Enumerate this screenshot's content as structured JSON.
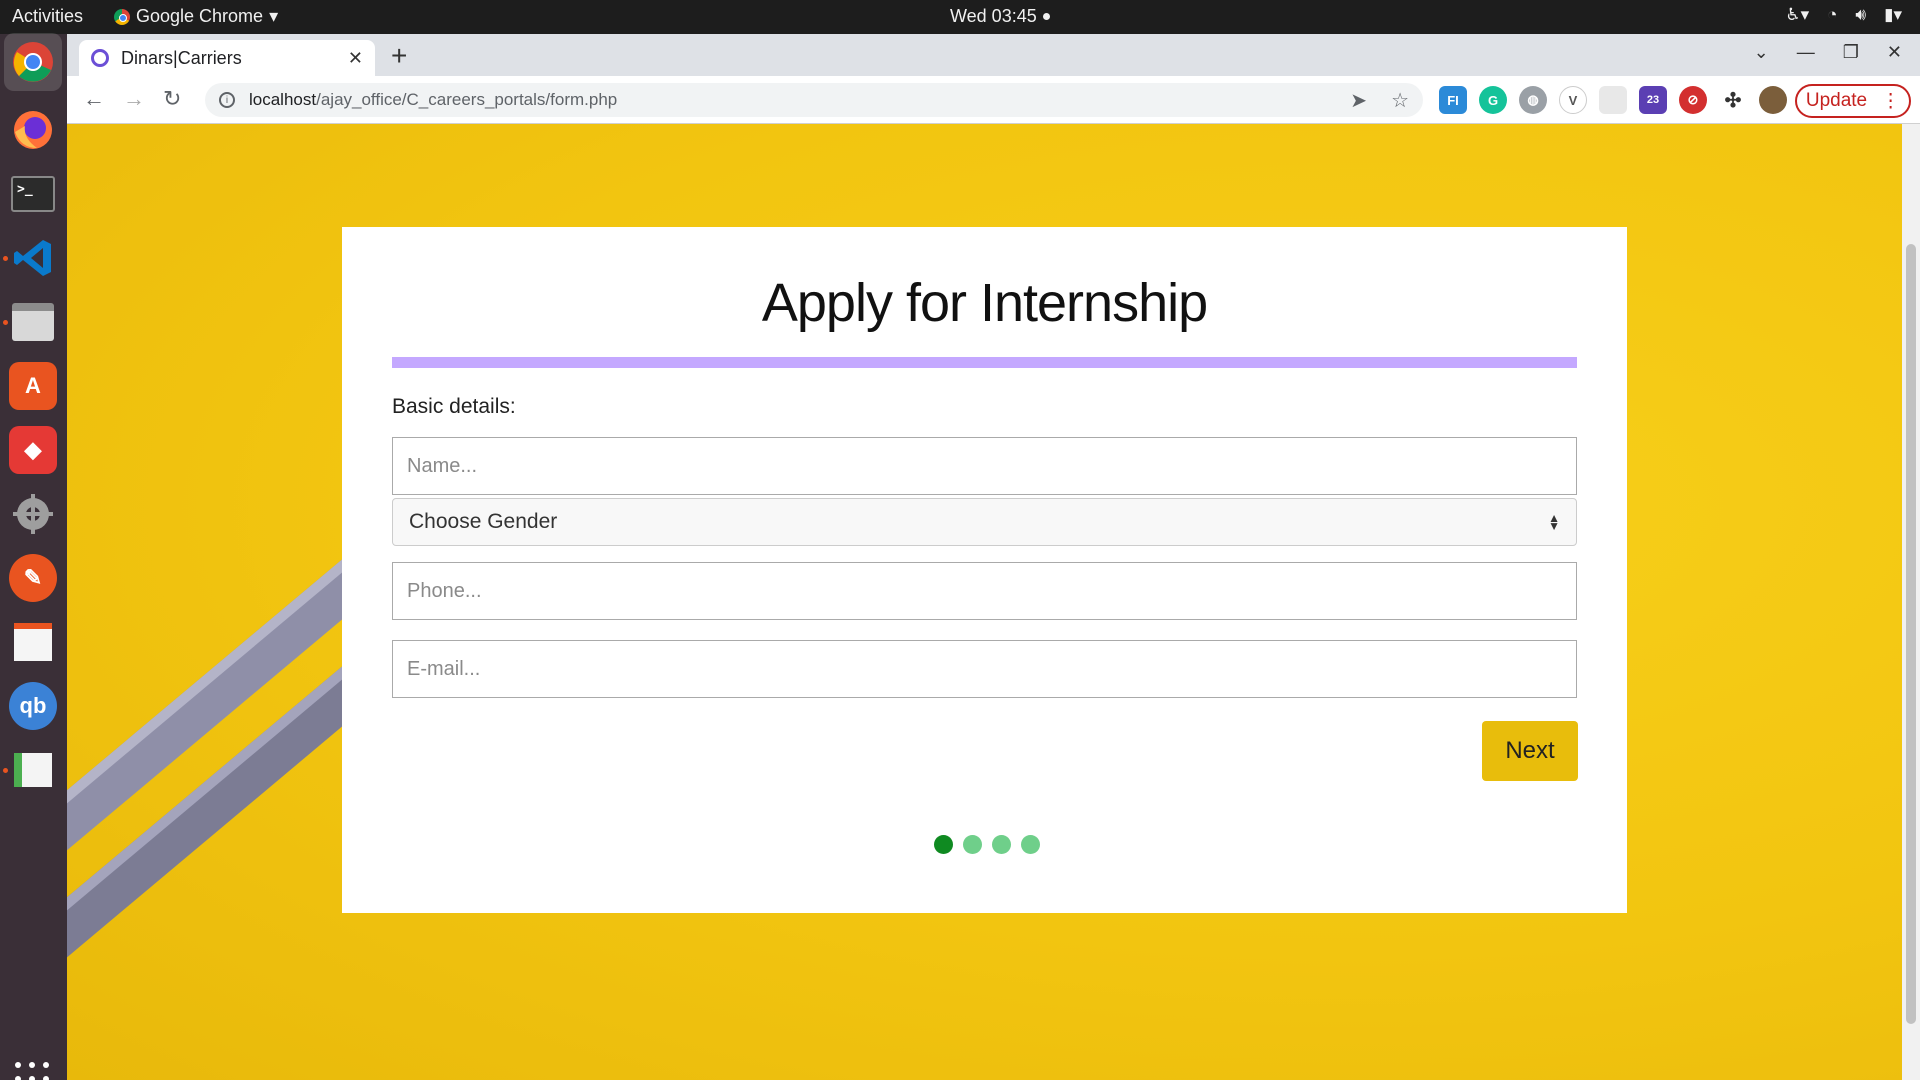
{
  "topbar": {
    "activities": "Activities",
    "app_name": "Google Chrome",
    "clock": "Wed 03:45"
  },
  "browser": {
    "tab_title": "Dinars|Carriers",
    "url_host": "localhost",
    "url_path": "/ajay_office/C_careers_portals/form.php",
    "update_label": "Update",
    "extension_badge": "23"
  },
  "form": {
    "title": "Apply for Internship",
    "section_label": "Basic details:",
    "name_placeholder": "Name...",
    "gender_selected": "Choose Gender",
    "phone_placeholder": "Phone...",
    "email_placeholder": "E-mail...",
    "next_label": "Next",
    "current_step": 1,
    "total_steps": 4
  },
  "colors": {
    "background_yellow": "#f2c510",
    "accent_bar": "#c4a8ff",
    "next_button": "#e8bd0c",
    "step_active": "#0f8a21",
    "step_inactive": "#6fcf8a",
    "update_red": "#c5221f"
  }
}
